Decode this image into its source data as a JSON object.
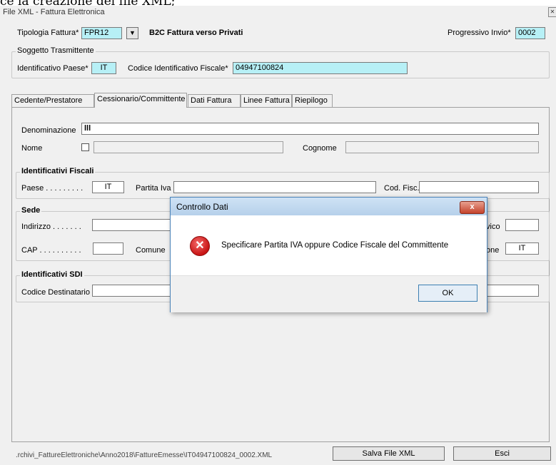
{
  "background_text": "ce la creazione del file XML;",
  "window": {
    "title": "File XML - Fattura Elettronica",
    "close_glyph": "✕"
  },
  "header": {
    "tipologia_label": "Tipologia Fattura*",
    "tipologia_value": "FPR12",
    "tipologia_desc": "B2C  Fattura verso Privati",
    "progressivo_label": "Progressivo Invio*",
    "progressivo_value": "0002"
  },
  "soggetto": {
    "title": "Soggetto Trasmittente",
    "paese_label": "Identificativo Paese*",
    "paese_value": "IT",
    "codice_label": "Codice Identificativo Fiscale*",
    "codice_value": "04947100824"
  },
  "tabs": [
    {
      "label": "Cedente/Prestatore"
    },
    {
      "label": "Cessionario/Committente"
    },
    {
      "label": "Dati Fattura"
    },
    {
      "label": "Linee Fattura"
    },
    {
      "label": "Riepilogo"
    }
  ],
  "form": {
    "denominazione_label": "Denominazione",
    "denominazione_value": "lll",
    "nome_label": "Nome",
    "cognome_label": "Cognome",
    "fiscali_title": "Identificativi Fiscali",
    "paese_label": "Paese . . . . . . . . .",
    "paese_value": "IT",
    "partita_iva_label": "Partita Iva",
    "cod_fisc_label": "Cod. Fisc.",
    "sede_title": "Sede",
    "indirizzo_label": "Indirizzo . . . . . . .",
    "civico_label": "vico",
    "cap_label": "CAP . . . . . . . . . .",
    "comune_label": "Comune",
    "nazione_label": "one",
    "nazione_value": "IT",
    "sdi_title": "Identificativi SDI",
    "codice_dest_label": "Codice Destinatario"
  },
  "footer": {
    "path": ".rchivi_FattureElettroniche\\Anno2018\\FattureEmesse\\IT04947100824_0002.XML",
    "save_label": "Salva File XML",
    "exit_label": "Esci"
  },
  "dialog": {
    "title": "Controllo Dati",
    "close_glyph": "x",
    "icon_glyph": "✕",
    "message": "Specificare Partita IVA oppure Codice Fiscale del Committente",
    "ok_label": "OK"
  }
}
